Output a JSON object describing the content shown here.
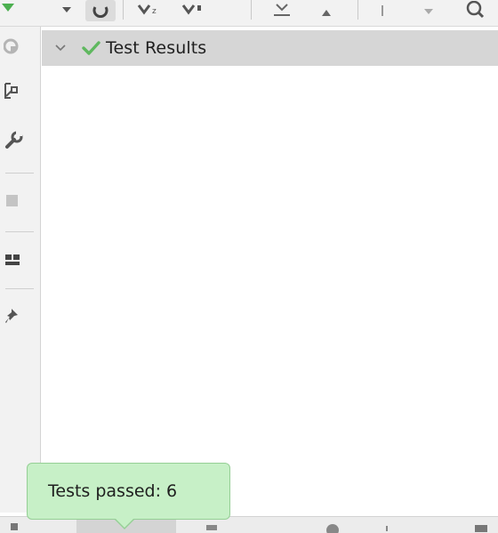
{
  "results_tree": {
    "root_label": "Test Results",
    "status": "passed"
  },
  "notification": {
    "text": "Tests passed: 6"
  },
  "icons": {
    "toolbar": [
      "run-icon",
      "dropdown-icon",
      "rerun-icon",
      "sort-alpha-icon",
      "sort-duration-icon",
      "expand-all-icon",
      "collapse-all-icon",
      "previous-icon",
      "next-icon",
      "search-icon"
    ],
    "gutter": [
      "rerun-failed-icon",
      "export-icon",
      "settings-icon",
      "stop-icon",
      "layout-icon",
      "pin-icon"
    ]
  },
  "colors": {
    "passed_green": "#5fb85f",
    "balloon_bg": "#c7f0c7",
    "row_selected": "#d6d6d6"
  }
}
